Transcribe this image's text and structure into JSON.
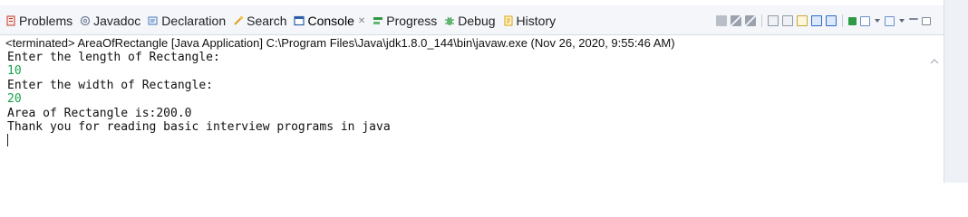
{
  "tabs": [
    {
      "label": "Problems",
      "icon": "problems-icon",
      "color": "#c0392b"
    },
    {
      "label": "Javadoc",
      "icon": "at-icon",
      "color": "#6a7a8f"
    },
    {
      "label": "Declaration",
      "icon": "declaration-icon",
      "color": "#4a76b8"
    },
    {
      "label": "Search",
      "icon": "search-icon",
      "color": "#e0a020"
    },
    {
      "label": "Console",
      "icon": "console-icon",
      "color": "#2f5fa8",
      "active": true
    },
    {
      "label": "Progress",
      "icon": "progress-icon",
      "color": "#2e9a45"
    },
    {
      "label": "Debug",
      "icon": "debug-icon",
      "color": "#2e9a45"
    },
    {
      "label": "History",
      "icon": "history-icon",
      "color": "#d9a200"
    }
  ],
  "console_close_glyph": "✕",
  "status": "<terminated> AreaOfRectangle [Java Application] C:\\Program Files\\Java\\jdk1.8.0_144\\bin\\javaw.exe (Nov 26, 2020, 9:55:46 AM)",
  "console_lines": [
    {
      "text": "Enter the length of Rectangle:",
      "input": false
    },
    {
      "text": "10",
      "input": true
    },
    {
      "text": "Enter the width of Rectangle:",
      "input": false
    },
    {
      "text": "20",
      "input": true
    },
    {
      "text": "Area of Rectangle is:200.0",
      "input": false
    },
    {
      "text": "Thank you for reading basic interview programs in java",
      "input": false
    }
  ],
  "colors": {
    "input_text": "#17a34a",
    "accent": "#2f5fa8"
  }
}
